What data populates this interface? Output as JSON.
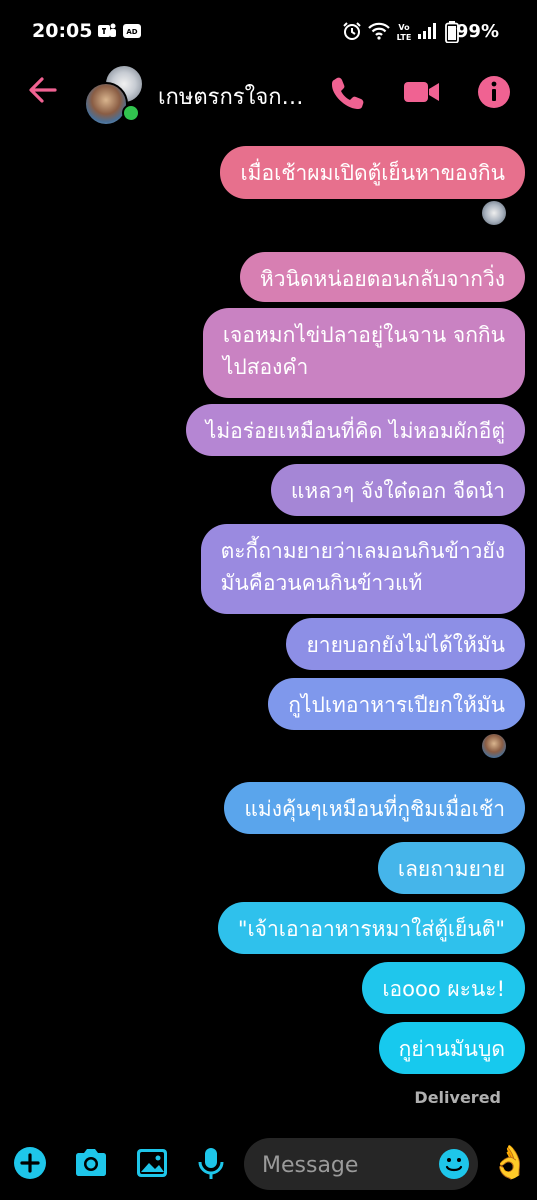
{
  "status_bar": {
    "time": "20:05",
    "left_icons": [
      "teams-icon",
      "ad-icon"
    ],
    "right_icons": [
      "alarm-icon",
      "wifi-icon",
      "volte-icon",
      "signal-icon",
      "battery-icon"
    ],
    "volte_label": "Vo\nLTE",
    "battery": "99%"
  },
  "header": {
    "chat_name": "เกษตรกรใจก…",
    "accent_color": "#f06292"
  },
  "messages": [
    {
      "text": "เมื่อเช้าผมเปิดตู้เย็นหาของกิน"
    },
    {
      "text": "หิวนิดหน่อยตอนกลับจากวิ่ง"
    },
    {
      "text": "เจอหมกไข่ปลาอยู่ในจาน จกกิน\nไปสองคำ"
    },
    {
      "text": "ไม่อร่อยเหมือนที่คิด ไม่หอมผักอีตู่"
    },
    {
      "text": "แหลวๆ จังใด๋ดอก จืดนำ"
    },
    {
      "text": "ตะกี้ถามยายว่าเลมอนกินข้าวยัง\nมันคือวนคนกินข้าวแท้"
    },
    {
      "text": "ยายบอกยังไม่ได้ให้มัน"
    },
    {
      "text": "กูไปเทอาหารเปียกให้มัน"
    },
    {
      "text": "แม่งคุ้นๆเหมือนที่กูชิมเมื่อเช้า"
    },
    {
      "text": "เลยถามยาย"
    },
    {
      "text": "\"เจ้าเอาอาหารหมาใส่ตู้เย็นติ\""
    },
    {
      "text": "เอooo ผะนะ!"
    },
    {
      "text": "กูย่านมันบูด"
    }
  ],
  "bubble_colors": [
    "#e7708d",
    "#d77fb2",
    "#c982c2",
    "#b586d3",
    "#a586d6",
    "#9a8ae0",
    "#8d8fe6",
    "#7f98ec",
    "#5aa5ec",
    "#45b5ea",
    "#2fc1ec",
    "#1fc6ec",
    "#17c9ee"
  ],
  "delivered_label": "Delivered",
  "composer": {
    "placeholder": "Message",
    "accent_color": "#1ec6ea",
    "thumb_emoji": "👌"
  }
}
